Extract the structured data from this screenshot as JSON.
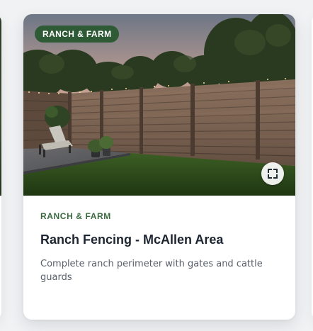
{
  "card": {
    "badge": "RANCH & FARM",
    "category": "RANCH & FARM",
    "title": "Ranch Fencing - McAllen Area",
    "description": "Complete ranch perimeter with gates and cattle guards",
    "expand_icon": "expand-icon"
  },
  "colors": {
    "badge_bg": "#2f5a36",
    "category_text": "#3a6a3f",
    "title_text": "#1c2530",
    "description_text": "#59606a"
  }
}
